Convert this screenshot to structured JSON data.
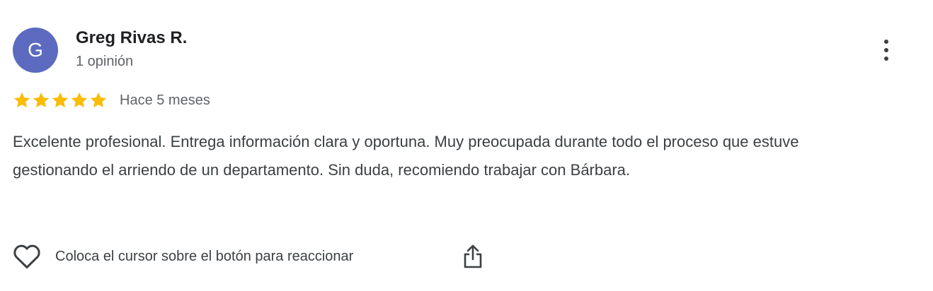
{
  "review": {
    "author": {
      "initial": "G",
      "name": "Greg Rivas R.",
      "reviews_count": "1 opinión",
      "avatar_color": "#5c6bc0"
    },
    "rating": {
      "value": 5,
      "max": 5,
      "star_color": "#fbbc04"
    },
    "date": "Hace 5 meses",
    "text": "Excelente profesional. Entrega información clara y oportuna. Muy preocupada durante todo el proceso que estuve gestionando el arriendo de un departamento. Sin duda, recomiendo trabajar con Bárbara.",
    "actions": {
      "react_label": "Coloca el cursor sobre el botón para reaccionar",
      "react_icon": "heart-outline-icon",
      "share_icon": "share-icon",
      "more_icon": "more-vertical-icon"
    }
  }
}
